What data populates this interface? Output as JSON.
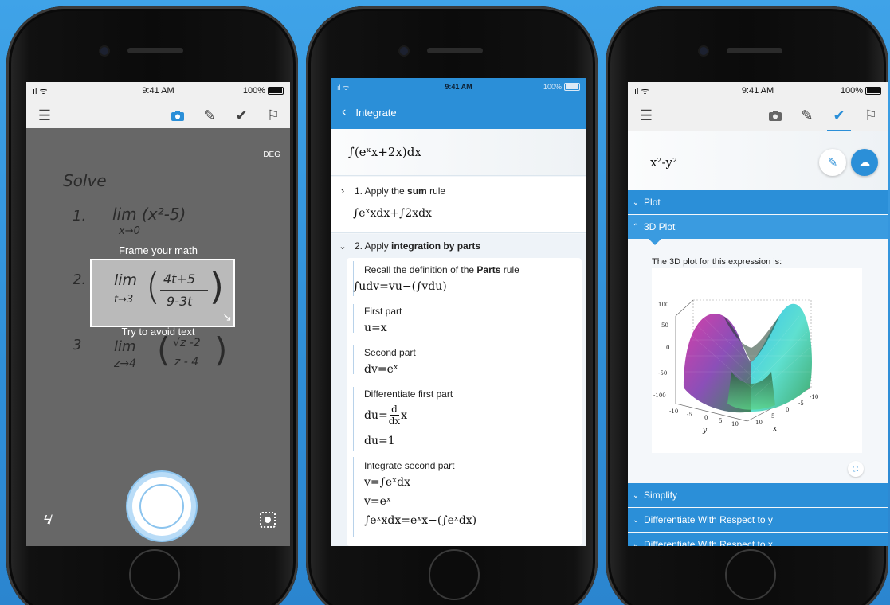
{
  "phone1": {
    "status": {
      "signal": "ıl ᯤ",
      "time": "9:41 AM",
      "battery": "100%"
    },
    "toolbar": {
      "menu_icon": "hamburger-icon",
      "camera_icon": "camera-icon",
      "pencil_icon": "pencil-icon",
      "check_icon": "check-icon",
      "flag_icon": "flag-icon"
    },
    "deg_label": "DEG",
    "handwriting": {
      "solve": "Solve",
      "item1_num": "1.",
      "item1_expr": "lim (x²-5)",
      "item1_sub": "x→0",
      "item2_num": "2.",
      "item3_num": "3",
      "item3_expr": "lim",
      "item3_sub": "z→4",
      "item3_top": "√z -2",
      "item3_bottom": "z - 4"
    },
    "frame": {
      "top_label": "Frame your math",
      "bottom_label": "Try to avoid text",
      "lim": "lim",
      "sub": "t→3",
      "numerator": "4t+5",
      "denominator": "9-3t"
    },
    "bottom": {
      "flash_icon": "flash-off-icon",
      "scan_icon": "focus-icon"
    }
  },
  "phone2": {
    "status": {
      "signal": "ıl ᯤ",
      "time": "9:41 AM",
      "battery": "100%"
    },
    "header": {
      "title": "Integrate"
    },
    "problem": "∫(eˣx+2x)dx",
    "step1": {
      "label_pre": "1. Apply the ",
      "label_bold": "sum",
      "label_post": " rule",
      "expr": "∫eˣxdx+∫2xdx"
    },
    "step2": {
      "label_pre": "2. Apply ",
      "label_bold": "integration by parts",
      "recall_pre": "Recall the definition of the ",
      "recall_bold": "Parts",
      "recall_post": " rule",
      "recall_expr": "∫udv=vu−(∫vdu)",
      "first_part": "First part",
      "first_expr": "u=x",
      "second_part": "Second part",
      "second_expr": "dv=eˣ",
      "diff_first": "Differentiate first part",
      "diff_expr_lhs": "du=",
      "diff_expr_num": "d",
      "diff_expr_den": "dx",
      "diff_expr_rhs": "x",
      "diff_result": "du=1",
      "int_second": "Integrate second part",
      "int_expr1": "v=∫eˣdx",
      "int_expr2": "v=eˣ",
      "int_expr3": "∫eˣxdx=eˣx−(∫eˣdx)"
    }
  },
  "phone3": {
    "status": {
      "signal": "ıl ᯤ",
      "time": "9:41 AM",
      "battery": "100%"
    },
    "toolbar": {
      "menu_icon": "hamburger-icon",
      "camera_icon": "camera-icon",
      "pencil_icon": "pencil-icon",
      "check_icon": "check-icon",
      "flag_icon": "flag-icon"
    },
    "expression": "x²-y²",
    "sections": {
      "plot": "Plot",
      "plot3d": "3D Plot",
      "simplify": "Simplify",
      "diff_y": "Differentiate With Respect to y",
      "diff_x": "Differentiate With Respect to x"
    },
    "plot_caption": "The 3D plot for this expression is:",
    "axis": {
      "z_ticks": [
        "100",
        "50",
        "0",
        "-50",
        "-100"
      ],
      "y_ticks": [
        "-10",
        "-5",
        "0",
        "5",
        "10"
      ],
      "x_ticks": [
        "10",
        "5",
        "0",
        "-5",
        "-10"
      ],
      "x_label": "x",
      "y_label": "y"
    }
  },
  "colors": {
    "accent": "#2b8fd8",
    "camera_bg": "#676767",
    "panel_bg": "#f4f7fa"
  }
}
